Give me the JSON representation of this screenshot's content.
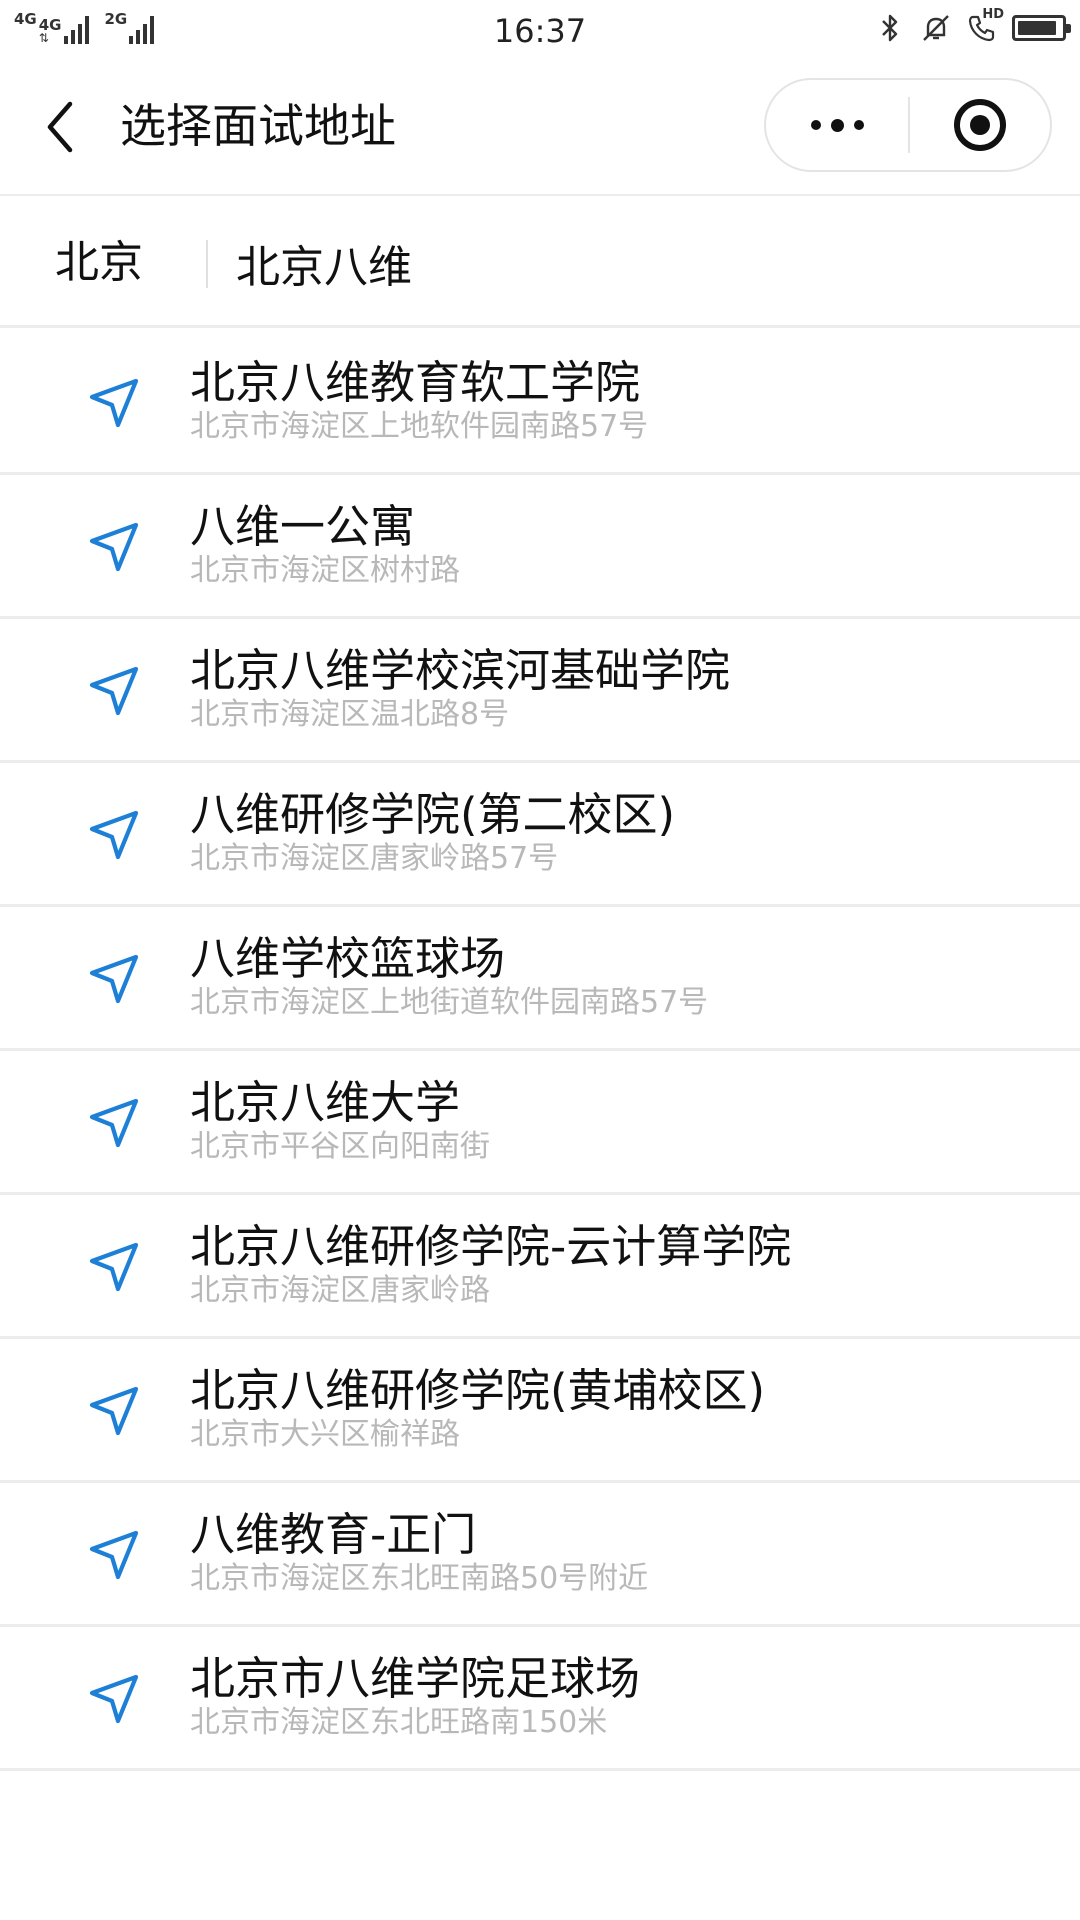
{
  "status_bar": {
    "net1": "4G",
    "net2": "4G",
    "net3": "2G",
    "time": "16:37",
    "hd": "HD",
    "battery_level": 0.9
  },
  "nav": {
    "title": "选择面试地址"
  },
  "search": {
    "city": "北京",
    "query": "北京八维"
  },
  "colors": {
    "accent": "#1e7fd6",
    "address_gray": "#b8b8b8"
  },
  "results": [
    {
      "name": "北京八维教育软工学院",
      "address": "北京市海淀区上地软件园南路57号"
    },
    {
      "name": "八维一公寓",
      "address": "北京市海淀区树村路"
    },
    {
      "name": "北京八维学校滨河基础学院",
      "address": "北京市海淀区温北路8号"
    },
    {
      "name": "八维研修学院(第二校区)",
      "address": "北京市海淀区唐家岭路57号"
    },
    {
      "name": "八维学校篮球场",
      "address": "北京市海淀区上地街道软件园南路57号"
    },
    {
      "name": "北京八维大学",
      "address": "北京市平谷区向阳南街"
    },
    {
      "name": "北京八维研修学院-云计算学院",
      "address": "北京市海淀区唐家岭路"
    },
    {
      "name": "北京八维研修学院(黄埔校区)",
      "address": "北京市大兴区榆祥路"
    },
    {
      "name": "八维教育-正门",
      "address": "北京市海淀区东北旺南路50号附近"
    },
    {
      "name": "北京市八维学院足球场",
      "address": "北京市海淀区东北旺路南150米"
    }
  ]
}
